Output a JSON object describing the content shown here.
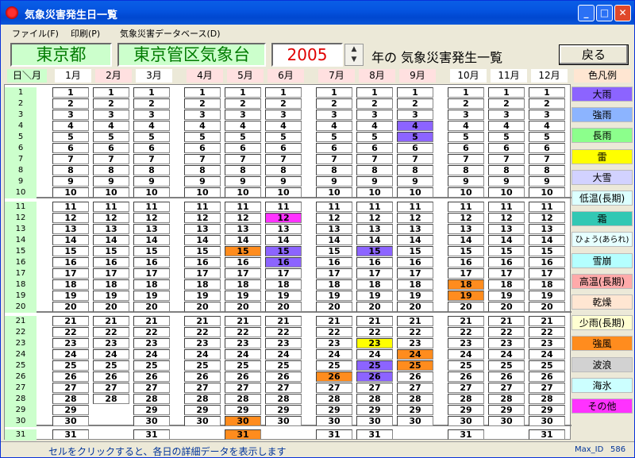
{
  "window": {
    "title": "気象災害発生日一覧"
  },
  "menu": [
    {
      "label": "ファイル(F)"
    },
    {
      "label": "印刷(P)"
    },
    {
      "label": "気象災害データベース(D)"
    }
  ],
  "header": {
    "prefecture": "東京都",
    "office": "東京管区気象台",
    "year": "2005",
    "year_suffix": "年の 気象災害発生一覧",
    "back_label": "戻る"
  },
  "grid": {
    "corner_label": "日＼月",
    "months": [
      "1月",
      "2月",
      "3月",
      "4月",
      "5月",
      "6月",
      "7月",
      "8月",
      "9月",
      "10月",
      "11月",
      "12月"
    ],
    "month_days": [
      31,
      28,
      31,
      30,
      31,
      30,
      31,
      31,
      30,
      31,
      30,
      31
    ]
  },
  "legend": {
    "title": "色凡例",
    "items": [
      {
        "label": "大雨",
        "color": "#8c64ff"
      },
      {
        "label": "強雨",
        "color": "#8cb4ff"
      },
      {
        "label": "長雨",
        "color": "#8cff8c"
      },
      {
        "label": "雷",
        "color": "#ffff00"
      },
      {
        "label": "大雪",
        "color": "#d2d2ff"
      },
      {
        "label": "低温(長期)",
        "color": "#dcffff"
      },
      {
        "label": "霜",
        "color": "#32c8b4"
      },
      {
        "label": "ひょう(あられ)",
        "color": "#e6ffff"
      },
      {
        "label": "雪崩",
        "color": "#b4ffff"
      },
      {
        "label": "高温(長期)",
        "color": "#ffaaaa"
      },
      {
        "label": "乾燥",
        "color": "#ffe6d2"
      },
      {
        "label": "少雨(長期)",
        "color": "#ffffd2"
      },
      {
        "label": "強風",
        "color": "#ff8c1e"
      },
      {
        "label": "波浪",
        "color": "#d2d2d2"
      },
      {
        "label": "海氷",
        "color": "#ccffff"
      },
      {
        "label": "その他",
        "color": "#ff32ff"
      }
    ]
  },
  "events": [
    {
      "month": 9,
      "day": 4,
      "color": "#8c64ff"
    },
    {
      "month": 9,
      "day": 5,
      "color": "#8c64ff"
    },
    {
      "month": 6,
      "day": 12,
      "color": "#ff32ff"
    },
    {
      "month": 5,
      "day": 15,
      "color": "#ff8c1e"
    },
    {
      "month": 6,
      "day": 15,
      "color": "#8c64ff"
    },
    {
      "month": 8,
      "day": 15,
      "color": "#8c64ff"
    },
    {
      "month": 6,
      "day": 16,
      "color": "#8c64ff"
    },
    {
      "month": 10,
      "day": 18,
      "color": "#ff8c1e"
    },
    {
      "month": 10,
      "day": 19,
      "color": "#ff8c1e"
    },
    {
      "month": 8,
      "day": 23,
      "color": "#ffff00"
    },
    {
      "month": 9,
      "day": 24,
      "color": "#ff8c1e"
    },
    {
      "month": 8,
      "day": 25,
      "color": "#8c64ff"
    },
    {
      "month": 9,
      "day": 25,
      "color": "#ff8c1e"
    },
    {
      "month": 7,
      "day": 26,
      "color": "#ff8c1e"
    },
    {
      "month": 8,
      "day": 26,
      "color": "#8c64ff"
    },
    {
      "month": 5,
      "day": 30,
      "color": "#ff8c1e"
    },
    {
      "month": 5,
      "day": 31,
      "color": "#ff8c1e"
    }
  ],
  "status": {
    "message": "セルをクリックすると、各日の詳細データを表示します",
    "id_label": "Max_ID",
    "id_value": "586"
  }
}
